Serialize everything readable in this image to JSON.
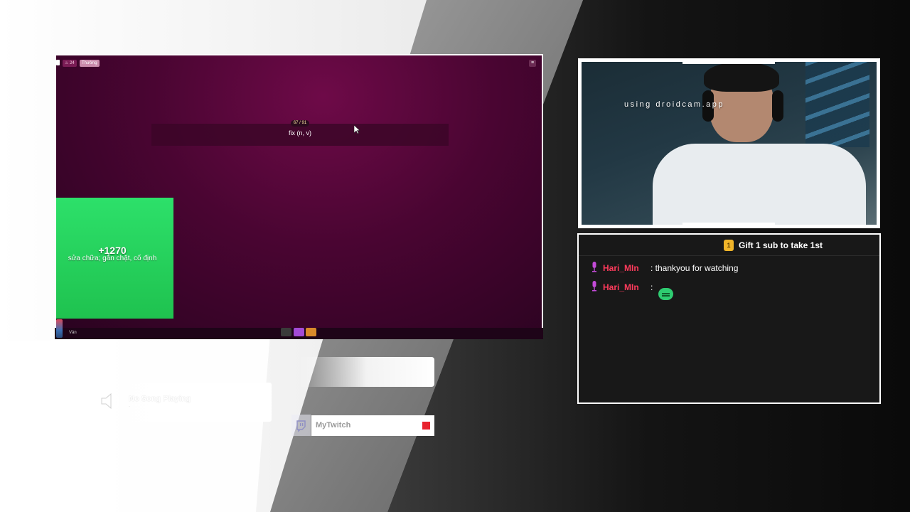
{
  "game": {
    "streak_count": "24",
    "mode_label": "Thường",
    "menu_glyph": "≡",
    "progress": "67 / 91",
    "word": "fix (n, v)",
    "answer": {
      "score": "+1270",
      "meaning": "sửa chữa; gắn chặt, cố định"
    },
    "player_name": "Vân"
  },
  "webcam": {
    "overlay_text": "using droidcam.app"
  },
  "chat": {
    "header": "Gift 1 sub to take 1st",
    "messages": [
      {
        "user": "Hari_MIn",
        "text": ": thankyou for watching"
      },
      {
        "user": "Hari_MIn",
        "text": ":"
      }
    ]
  },
  "song_widget": {
    "title": "No Song Playing",
    "subtitle": "-"
  },
  "twitch_widget": {
    "name": "MyTwitch"
  },
  "colors": {
    "game_bg": "#4a0532",
    "answer_green": "#2de06a",
    "chat_user": "#ff3b5c",
    "live_red": "#e8222e"
  }
}
